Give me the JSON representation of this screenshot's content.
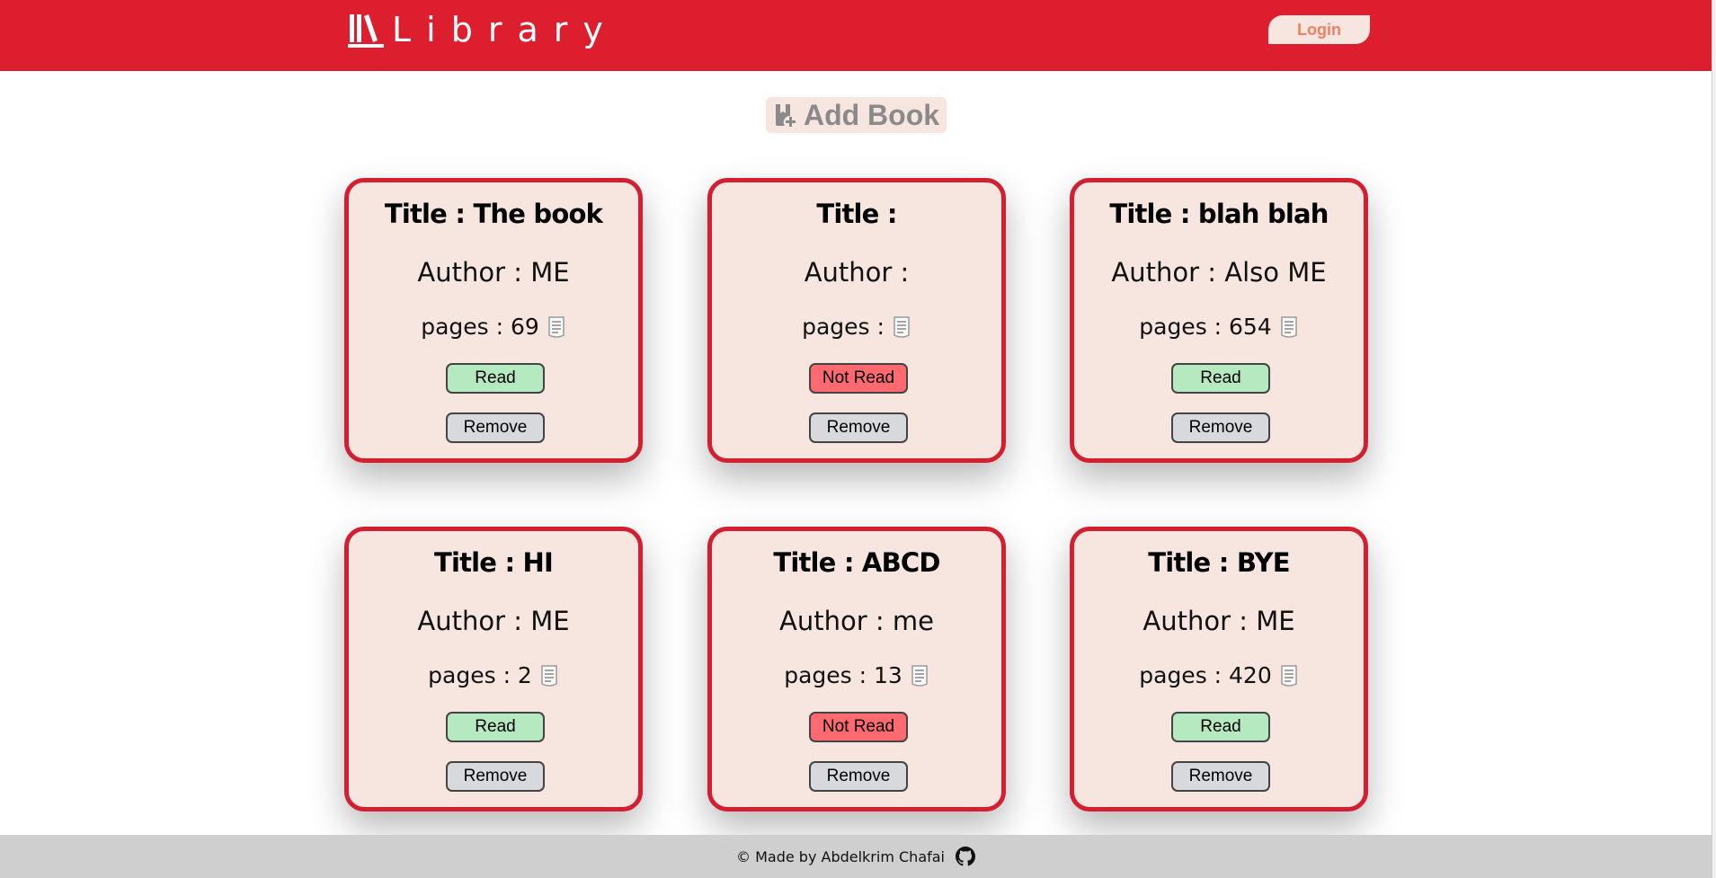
{
  "header": {
    "logo_text": "Library",
    "login_label": "Login"
  },
  "add_book_label": "Add Book",
  "books": [
    {
      "title": "Title : The book",
      "author": "Author : ME",
      "pages": "pages : 69",
      "status": "Read",
      "remove": "Remove"
    },
    {
      "title": "Title :",
      "author": "Author :",
      "pages": "pages :",
      "status": "Not Read",
      "remove": "Remove"
    },
    {
      "title": "Title : blah blah",
      "author": "Author : Also ME",
      "pages": "pages : 654",
      "status": "Read",
      "remove": "Remove"
    },
    {
      "title": "Title : HI",
      "author": "Author : ME",
      "pages": "pages : 2",
      "status": "Read",
      "remove": "Remove"
    },
    {
      "title": "Title : ABCD",
      "author": "Author : me",
      "pages": "pages : 13",
      "status": "Not Read",
      "remove": "Remove"
    },
    {
      "title": "Title : BYE",
      "author": "Author : ME",
      "pages": "pages : 420",
      "status": "Read",
      "remove": "Remove"
    }
  ],
  "footer": {
    "text": "© Made by Abdelkrim Chafai",
    "icon": "github-icon"
  },
  "colors": {
    "header": "#dc1e2e",
    "card_bg": "#f6e6df",
    "card_border": "#d41f30",
    "read": "#b5e9c0",
    "not_read": "#ff6a70",
    "remove": "#d7d9dd",
    "footer": "#cfcfcf"
  }
}
